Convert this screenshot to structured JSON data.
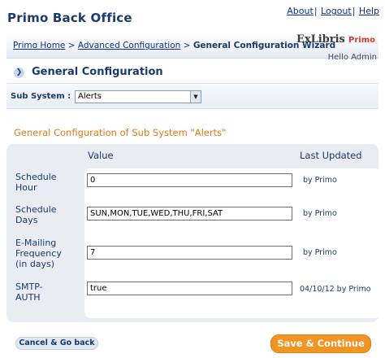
{
  "app": {
    "title": "Primo Back Office"
  },
  "top_links": {
    "about": "About",
    "logout": "Logout",
    "help": "Help",
    "separator": "|"
  },
  "breadcrumb": {
    "home": "Primo Home",
    "separator": ">",
    "advanced": "Advanced Configuration",
    "current": "General Configuration Wizard"
  },
  "logo": {
    "brand": "ExLibris",
    "product": "Primo"
  },
  "greeting": "Hello Admin",
  "section": {
    "title": "General Configuration",
    "arrow_icon": "chevron-right-icon"
  },
  "sub_system": {
    "label": "Sub System :",
    "selected": "Alerts"
  },
  "config_title": "General Configuration of Sub System \"Alerts\"",
  "table": {
    "value_header": "Value",
    "updated_header": "Last Updated",
    "rows": [
      {
        "label_line1": "Schedule",
        "label_line2": "Hour",
        "label_line3": "",
        "value": "0",
        "last_updated": "by Primo"
      },
      {
        "label_line1": "Schedule",
        "label_line2": "Days",
        "label_line3": "",
        "value": "SUN,MON,TUE,WED,THU,FRI,SAT",
        "last_updated": "by Primo"
      },
      {
        "label_line1": "E-Mailing",
        "label_line2": "Frequency",
        "label_line3": "(in days)",
        "value": "7",
        "last_updated": "by Primo"
      },
      {
        "label_line1": "SMTP-",
        "label_line2": "AUTH",
        "label_line3": "",
        "value": "true",
        "last_updated": "04/10/12  by Primo"
      }
    ]
  },
  "buttons": {
    "cancel": "Cancel & Go back",
    "save": "Save & Continue"
  },
  "colors": {
    "accent": "#f19421",
    "heading": "#1b3a6b",
    "link": "#0a2f9a",
    "config_title": "#e07b14"
  }
}
